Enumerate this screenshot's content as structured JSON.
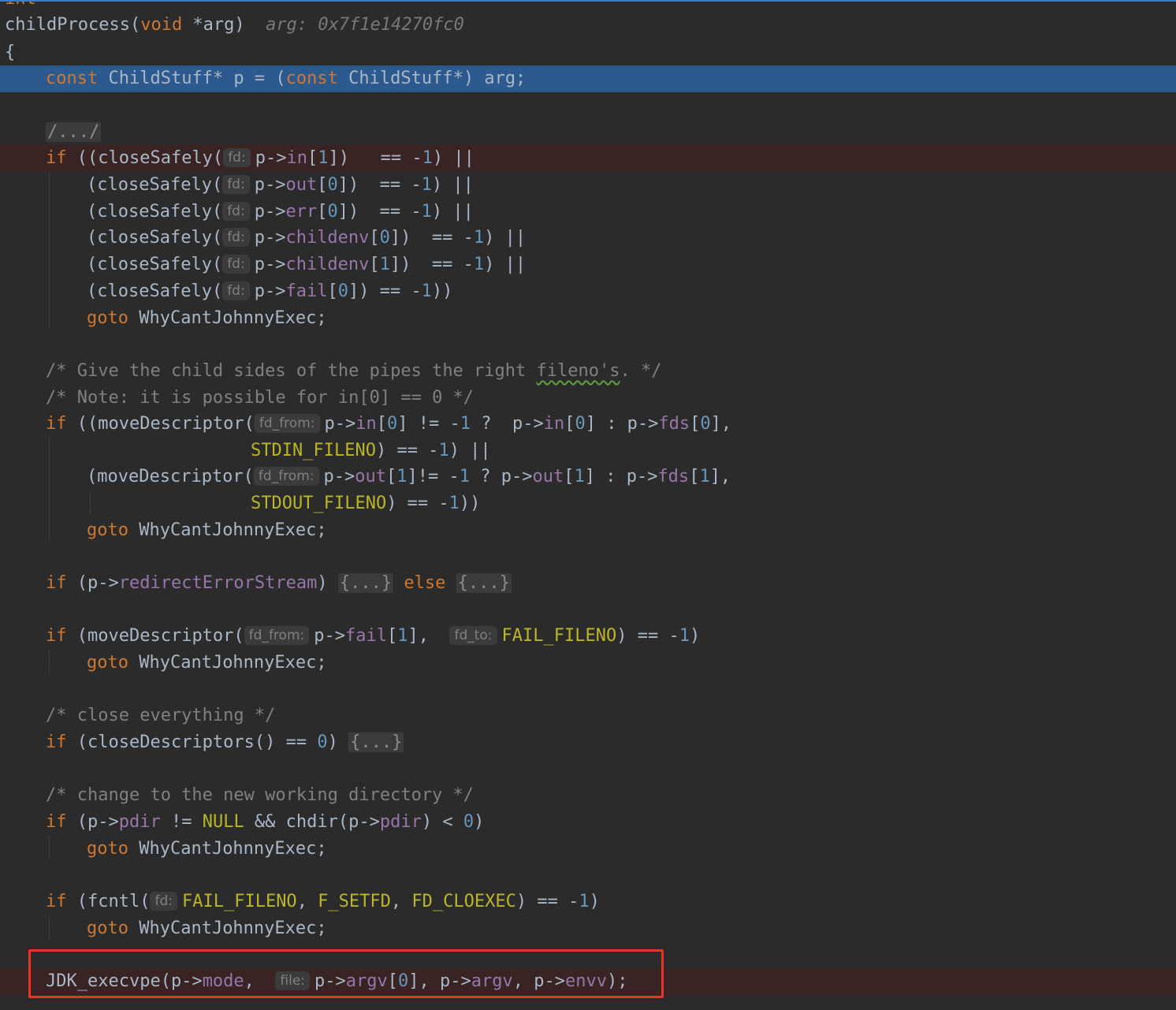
{
  "editor": {
    "title_fragment": "int",
    "highlight_color": "#e8352a",
    "current_line_color": "#2d5a8e",
    "breakpoint_line_color": "#3a2323",
    "lines": {
      "l1": {
        "name": "childProcess",
        "p1": "(",
        "kw": "void",
        "p2": " *arg)",
        "debug": "arg: 0x7f1e14270fc0"
      },
      "l2": {
        "text": "{"
      },
      "l3": {
        "kw1": "const",
        "t1": " ChildStuff* p = (",
        "kw2": "const",
        "t2": " ChildStuff*) arg;"
      },
      "l4": {
        "fold": "/.../"
      },
      "l5": {
        "kw": "if",
        "t1": " ((closeSafely(",
        "hint": "fd:",
        "t2": "p->",
        "fld": "in",
        "t3": "[",
        "num": "1",
        "t4": "])   == -",
        "num2": "1",
        "t5": ") ||"
      },
      "l6": {
        "t1": "(closeSafely(",
        "hint": "fd:",
        "t2": "p->",
        "fld": "out",
        "t3": "[",
        "num": "0",
        "t4": "])  == -",
        "num2": "1",
        "t5": ") ||"
      },
      "l7": {
        "t1": "(closeSafely(",
        "hint": "fd:",
        "t2": "p->",
        "fld": "err",
        "t3": "[",
        "num": "0",
        "t4": "])  == -",
        "num2": "1",
        "t5": ") ||"
      },
      "l8": {
        "t1": "(closeSafely(",
        "hint": "fd:",
        "t2": "p->",
        "fld": "childenv",
        "t3": "[",
        "num": "0",
        "t4": "])  == -",
        "num2": "1",
        "t5": ") ||"
      },
      "l9": {
        "t1": "(closeSafely(",
        "hint": "fd:",
        "t2": "p->",
        "fld": "childenv",
        "t3": "[",
        "num": "1",
        "t4": "])  == -",
        "num2": "1",
        "t5": ") ||"
      },
      "l10": {
        "t1": "(closeSafely(",
        "hint": "fd:",
        "t2": "p->",
        "fld": "fail",
        "t3": "[",
        "num": "0",
        "t4": "]) == -",
        "num2": "1",
        "t5": "))"
      },
      "l11": {
        "kw": "goto",
        "t1": " WhyCantJohnnyExec;"
      },
      "l12": {
        "c1": "/* Give the child sides of the pipes the right ",
        "sq": "fileno's",
        "c2": ". */"
      },
      "l13": {
        "text": "/* Note: it is possible for in[0] == 0 */"
      },
      "l14": {
        "kw": "if",
        "t1": " ((moveDescriptor(",
        "hint": "fd_from:",
        "t2": "p->",
        "fld1": "in",
        "t3": "[",
        "num1": "0",
        "t4": "] != -",
        "num2": "1",
        "t5": " ?  p->",
        "fld2": "in",
        "t6": "[",
        "num3": "0",
        "t7": "] : p->",
        "fld3": "fds",
        "t8": "[",
        "num4": "0",
        "t9": "],"
      },
      "l15": {
        "mac": "STDIN_FILENO",
        "t1": ") == -",
        "num": "1",
        "t2": ") ||"
      },
      "l16": {
        "t1": "(moveDescriptor(",
        "hint": "fd_from:",
        "t2": "p->",
        "fld1": "out",
        "t3": "[",
        "num1": "1",
        "t4": "]!= -",
        "num2": "1",
        "t5": " ? p->",
        "fld2": "out",
        "t6": "[",
        "num3": "1",
        "t7": "] : p->",
        "fld3": "fds",
        "t8": "[",
        "num4": "1",
        "t9": "],"
      },
      "l17": {
        "mac": "STDOUT_FILENO",
        "t1": ") == -",
        "num": "1",
        "t2": "))"
      },
      "l18": {
        "kw": "goto",
        "t1": " WhyCantJohnnyExec;"
      },
      "l19": {
        "kw": "if",
        "t1": " (p->",
        "fld": "redirectErrorStream",
        "t2": ") ",
        "fold1": "{...}",
        "kw2": "else",
        "fold2": "{...}"
      },
      "l20": {
        "kw": "if",
        "t1": " (moveDescriptor(",
        "hint1": "fd_from:",
        "t2": "p->",
        "fld": "fail",
        "t3": "[",
        "num1": "1",
        "t4": "],  ",
        "hint2": "fd_to:",
        "mac": "FAIL_FILENO",
        "t5": ") == -",
        "num2": "1",
        "t6": ")"
      },
      "l21": {
        "kw": "goto",
        "t1": " WhyCantJohnnyExec;"
      },
      "l22": {
        "text": "/* close everything */"
      },
      "l23": {
        "kw": "if",
        "t1": " (closeDescriptors() == ",
        "num": "0",
        "t2": ") ",
        "fold": "{...}"
      },
      "l24": {
        "text": "/* change to the new working directory */"
      },
      "l25": {
        "kw": "if",
        "t1": " (p->",
        "fld1": "pdir",
        "t2": " != ",
        "mac": "NULL",
        "t3": " && chdir(p->",
        "fld2": "pdir",
        "t4": ") < ",
        "num": "0",
        "t5": ")"
      },
      "l26": {
        "kw": "goto",
        "t1": " WhyCantJohnnyExec;"
      },
      "l27": {
        "kw": "if",
        "t1": " (fcntl(",
        "hint": "fd:",
        "mac1": "FAIL_FILENO",
        "t2": ", ",
        "mac2": "F_SETFD",
        "t3": ", ",
        "mac3": "FD_CLOEXEC",
        "t4": ") == -",
        "num": "1",
        "t5": ")"
      },
      "l28": {
        "kw": "goto",
        "t1": " WhyCantJohnnyExec;"
      },
      "l29": {
        "t1": "JDK_execvpe(p->",
        "fld1": "mode",
        "t2": ",  ",
        "hint": "file:",
        "t3": "p->",
        "fld2": "argv",
        "t4": "[",
        "num": "0",
        "t5": "], p->",
        "fld3": "argv",
        "t6": ", p->",
        "fld4": "envv",
        "t7": ");"
      }
    }
  }
}
